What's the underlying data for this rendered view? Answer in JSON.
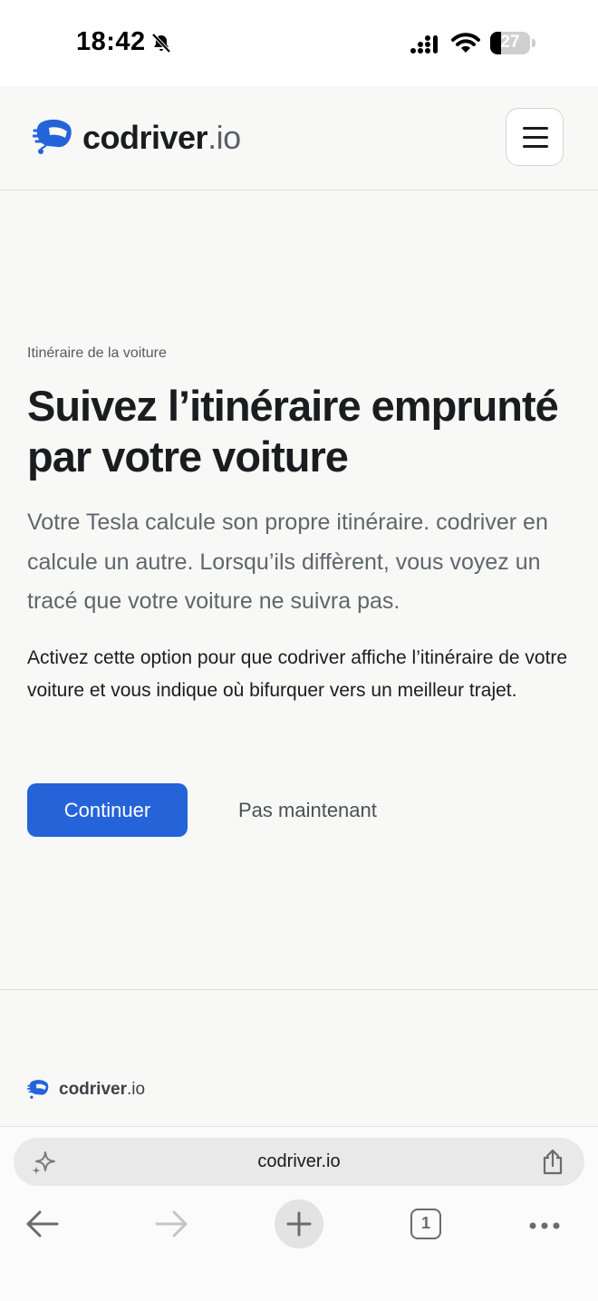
{
  "status_bar": {
    "time": "18:42",
    "battery_percent": "27",
    "battery_level": 0.27,
    "icons": [
      "bell-slash-icon",
      "cellular-signal-icon",
      "wifi-icon",
      "battery-icon"
    ]
  },
  "header": {
    "brand_name": "codriver",
    "brand_tld": ".io",
    "logo_icon": "helmet-logo-icon",
    "menu_icon": "hamburger-menu-icon",
    "brand_color": "#2563d9"
  },
  "main": {
    "eyebrow": "Itinéraire de la voiture",
    "title": "Suivez l’itinéraire emprunté par votre voiture",
    "lead": "Votre Tesla calcule son propre itinéraire. codriver en calcule un autre. Lorsqu’ils diffèrent, vous voyez un tracé que votre voiture ne suivra pas.",
    "body": "Activez cette option pour que codriver affiche l’itinéraire de votre voiture et vous indique où bifurquer vers un meilleur trajet.",
    "primary_button": "Continuer",
    "secondary_button": "Pas maintenant"
  },
  "footer": {
    "brand_name": "codriver",
    "brand_tld": ".io"
  },
  "browser": {
    "url": "codriver.io",
    "tab_count": "1",
    "icons": [
      "sparkle-icon",
      "share-icon",
      "back-arrow-icon",
      "forward-arrow-icon",
      "new-tab-icon",
      "tabs-icon",
      "more-icon"
    ]
  }
}
